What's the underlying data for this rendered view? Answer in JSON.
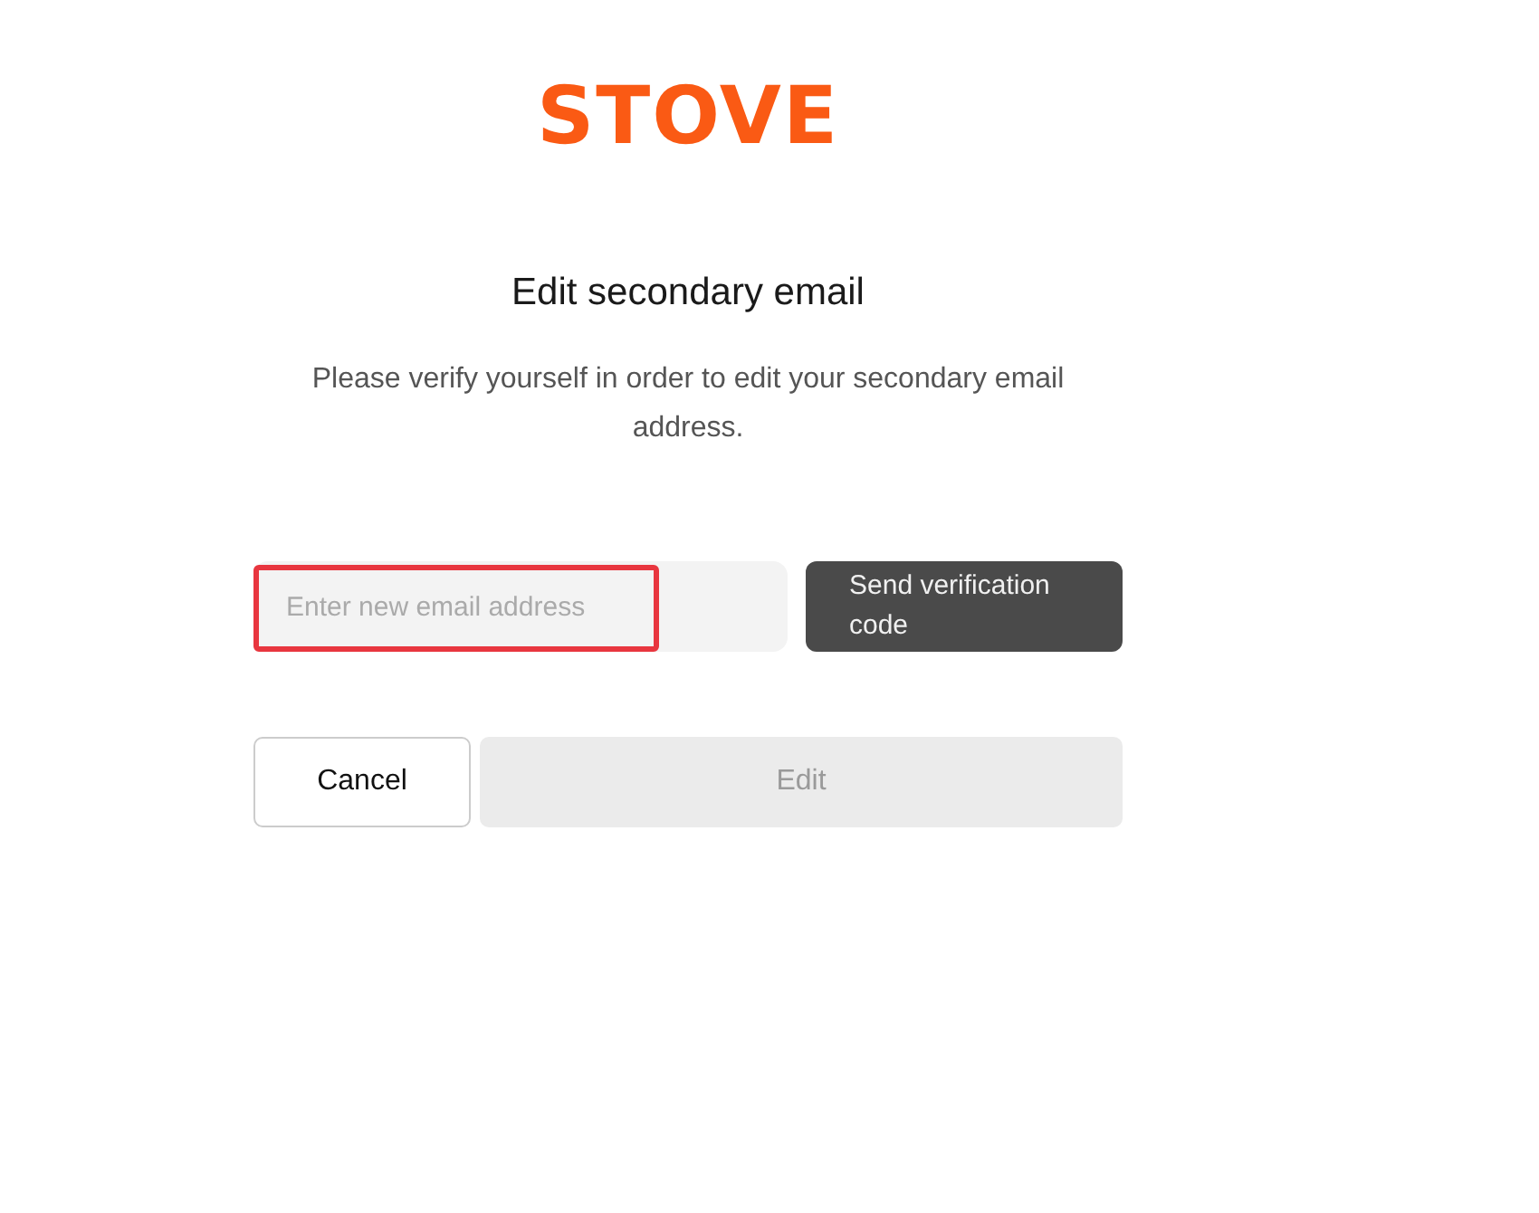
{
  "logo": "STOVE",
  "title": "Edit secondary email",
  "description": "Please verify yourself in order to edit your secondary email address.",
  "email_field": {
    "placeholder": "Enter new email address",
    "highlighted": true
  },
  "send_button": {
    "label": "Send verification code",
    "disabled": false
  },
  "buttons": [
    {
      "label": "Cancel",
      "kind": "secondary",
      "disabled": false
    },
    {
      "label": "Edit",
      "kind": "primary",
      "disabled": true
    }
  ]
}
